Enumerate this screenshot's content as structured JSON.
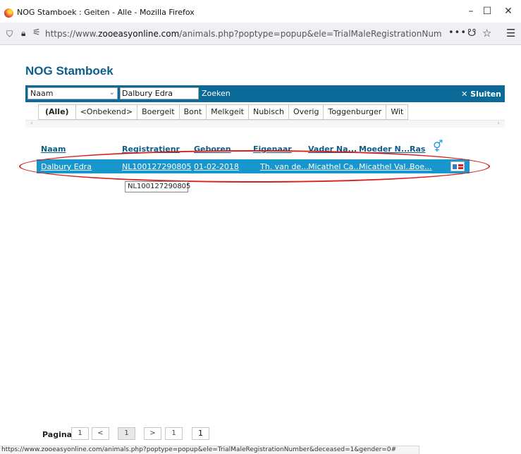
{
  "window": {
    "title": "NOG Stamboek : Geiten - Alle - Mozilla Firefox",
    "minimize": "–",
    "maximize": "☐",
    "close": "✕"
  },
  "address_bar": {
    "url_prefix": "https://www.",
    "url_domain": "zooeasyonline.com",
    "url_rest": "/animals.php?poptype=popup&ele=TrialMaleRegistrationNumber&desea",
    "more": "•••"
  },
  "page": {
    "title": "NOG Stamboek"
  },
  "search": {
    "field_select": "Naam",
    "query": "Dalbury Edra",
    "search_label": "Zoeken",
    "close_label": "✕ Sluiten"
  },
  "tabs": [
    {
      "label": "(Alle)"
    },
    {
      "label": "<Onbekend>"
    },
    {
      "label": "Boergeit"
    },
    {
      "label": "Bont"
    },
    {
      "label": "Melkgeit"
    },
    {
      "label": "Nubisch"
    },
    {
      "label": "Overig"
    },
    {
      "label": "Toggenburger"
    },
    {
      "label": "Wit"
    }
  ],
  "table": {
    "headers": {
      "naam": "Naam",
      "registratie": "Registratienr",
      "geboren": "Geboren",
      "eigenaar": "Eigenaar",
      "vader": "Vader Na...",
      "moeder": "Moeder N...",
      "ras": "Ras",
      "gender": "⚥"
    },
    "rows": [
      {
        "naam": "Dalbury Edra",
        "registratie": "NL100127290805",
        "geboren": "01-02-2018",
        "eigenaar": "Th. van de...",
        "vader": "Micathel Ca...",
        "moeder": "Micathel Val...",
        "ras": "Boe..."
      }
    ]
  },
  "tooltip": "NL100127290805",
  "pager": {
    "label": "Pagina",
    "first": "1",
    "prev": "<",
    "current": "1",
    "next": ">",
    "last": "1",
    "goto_value": "1"
  },
  "status_bar": "https://www.zooeasyonline.com/animals.php?poptype=popup&ele=TrialMaleRegistrationNumber&deceased=1&gender=0#",
  "colors": {
    "brand": "#0b5f8a",
    "toolbar": "#0b6a97",
    "selected_row": "#1897cf",
    "highlight_ellipse": "#d9201e"
  }
}
